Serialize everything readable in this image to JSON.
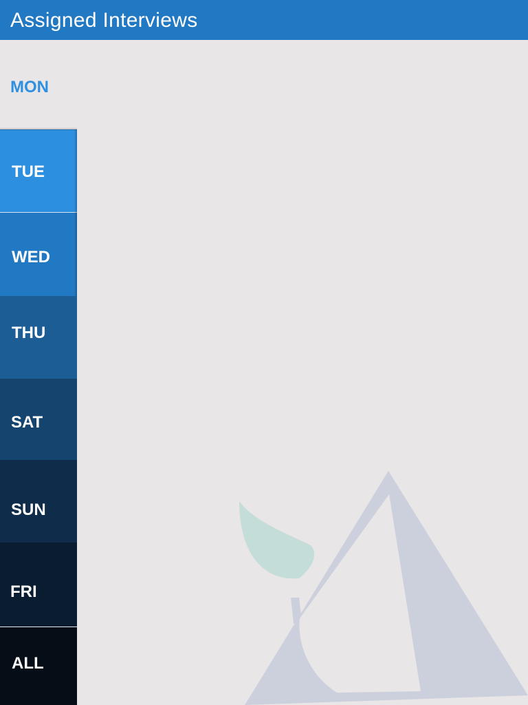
{
  "header": {
    "title": "Assigned Interviews"
  },
  "days": {
    "mon": "MON",
    "tue": "TUE",
    "wed": "WED",
    "thu": "THU",
    "sat": "SAT",
    "sun": "SUN",
    "fri": "FRI",
    "all": "ALL"
  },
  "colors": {
    "app_bar": "#2279c3",
    "selected_label": "#2f8fe0",
    "background": "#e8e6e7",
    "watermark_leaf": "#c5ddd8",
    "watermark_triangle": "#cccfdc"
  },
  "icons": {
    "watermark": "leaf-triangle-logo-icon"
  }
}
